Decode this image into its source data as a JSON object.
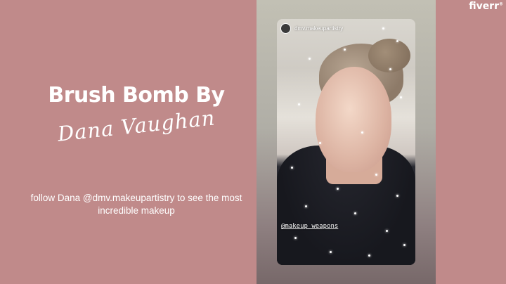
{
  "brand": {
    "logo_text": "fiverr",
    "logo_mark": "®"
  },
  "promo": {
    "title": "Brush Bomb By",
    "script_name": "Dana Vaughan",
    "description": "follow Dana @dmv.makeupartistry to see the most incredible makeup"
  },
  "story": {
    "username": "dmv.makeupartistry",
    "tag": "@makeup_weapons"
  },
  "colors": {
    "background": "#c08a8a",
    "text": "#ffffff"
  }
}
